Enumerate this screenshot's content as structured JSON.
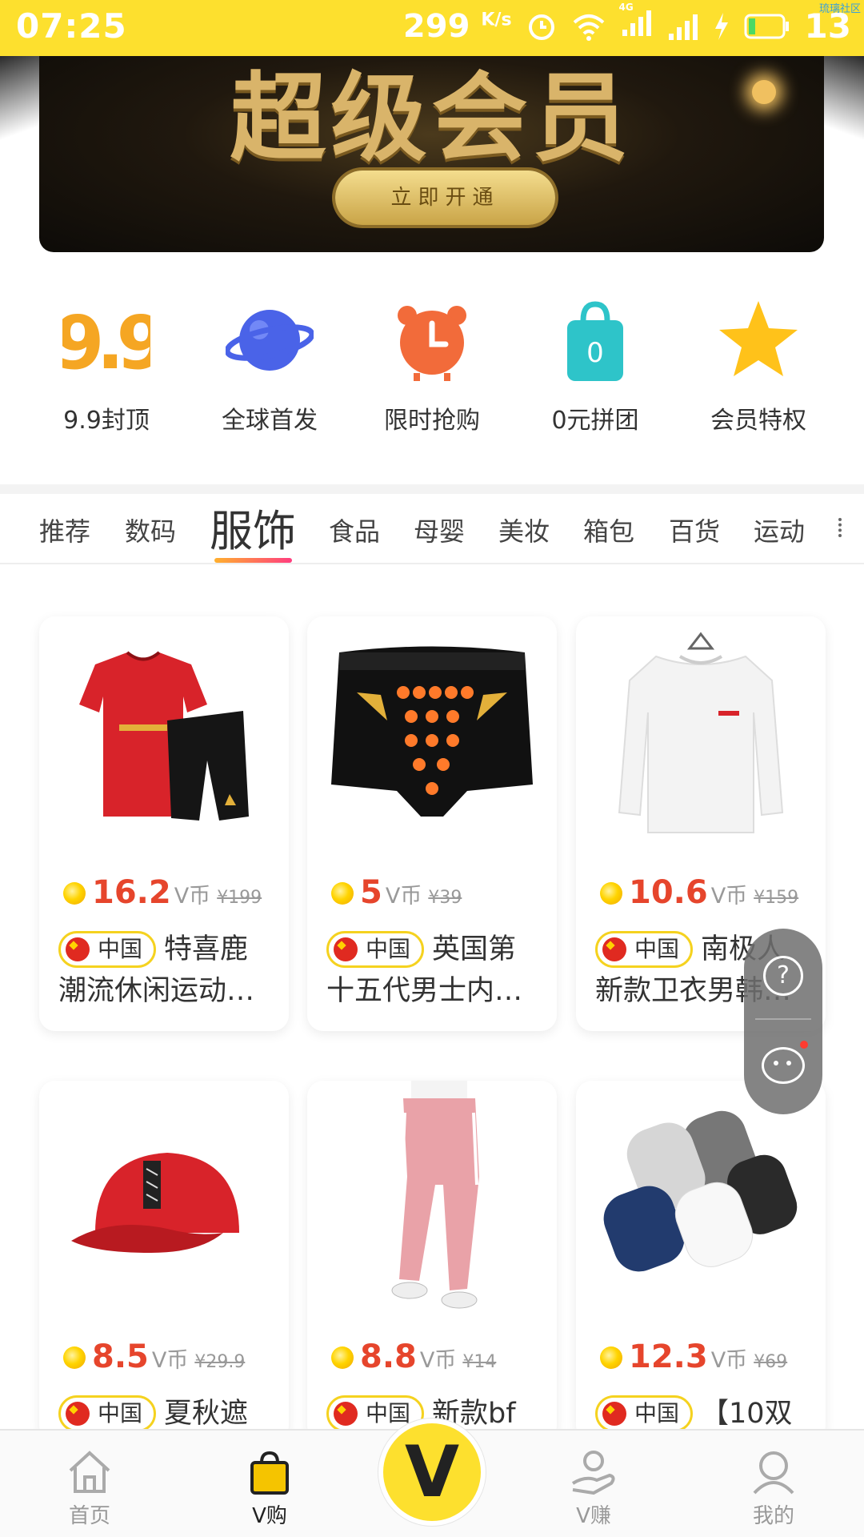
{
  "status_bar": {
    "time": "07:25",
    "speed": "299",
    "speed_unit": "K/s",
    "network": "4G",
    "battery": "13",
    "corner_label": "琉璃社区"
  },
  "banner": {
    "title": "超级会员",
    "button_label": "立即开通"
  },
  "quick_entries": [
    {
      "label": "9.9封顶",
      "icon": "nine-nine-icon",
      "color": "#f5a623"
    },
    {
      "label": "全球首发",
      "icon": "planet-icon",
      "color": "#4a63e8"
    },
    {
      "label": "限时抢购",
      "icon": "alarm-clock-icon",
      "color": "#f26b3a"
    },
    {
      "label": "0元拼团",
      "icon": "shopping-bag-icon",
      "color": "#2ec4c9"
    },
    {
      "label": "会员特权",
      "icon": "star-icon",
      "color": "#ffc21a"
    }
  ],
  "quick_icon_text": {
    "nine": "9.9",
    "bag": "0"
  },
  "tabs": [
    "推荐",
    "数码",
    "服饰",
    "食品",
    "母婴",
    "美妆",
    "箱包",
    "百货",
    "运动"
  ],
  "active_tab": "服饰",
  "origin_label": "中国",
  "currency_unit": "V币",
  "products": [
    {
      "price": "16.2",
      "original": "¥199",
      "title_line1": "特喜鹿",
      "title_line2": "潮流休闲运动衣…",
      "image": "red-sport-suit"
    },
    {
      "price": "5",
      "original": "¥39",
      "title_line1": "英国第",
      "title_line2": "十五代男士内裤…",
      "image": "black-underwear"
    },
    {
      "price": "10.6",
      "original": "¥159",
      "title_line1": "南极人",
      "title_line2": "新款卫衣男韩版…",
      "image": "white-sweatshirt"
    },
    {
      "price": "8.5",
      "original": "¥29.9",
      "title_line1": "夏秋遮",
      "title_line2": "",
      "image": "red-cap"
    },
    {
      "price": "8.8",
      "original": "¥14",
      "title_line1": "新款bf",
      "title_line2": "",
      "image": "pink-pants"
    },
    {
      "price": "12.3",
      "original": "¥69",
      "title_line1": "【10双",
      "title_line2": "",
      "image": "socks-pack"
    }
  ],
  "float_widget": {
    "help_symbol": "?"
  },
  "bottom_nav": {
    "home": "首页",
    "vgou": "V购",
    "center": "V",
    "vzhuan": "V赚",
    "mine": "我的",
    "active": "V购"
  }
}
